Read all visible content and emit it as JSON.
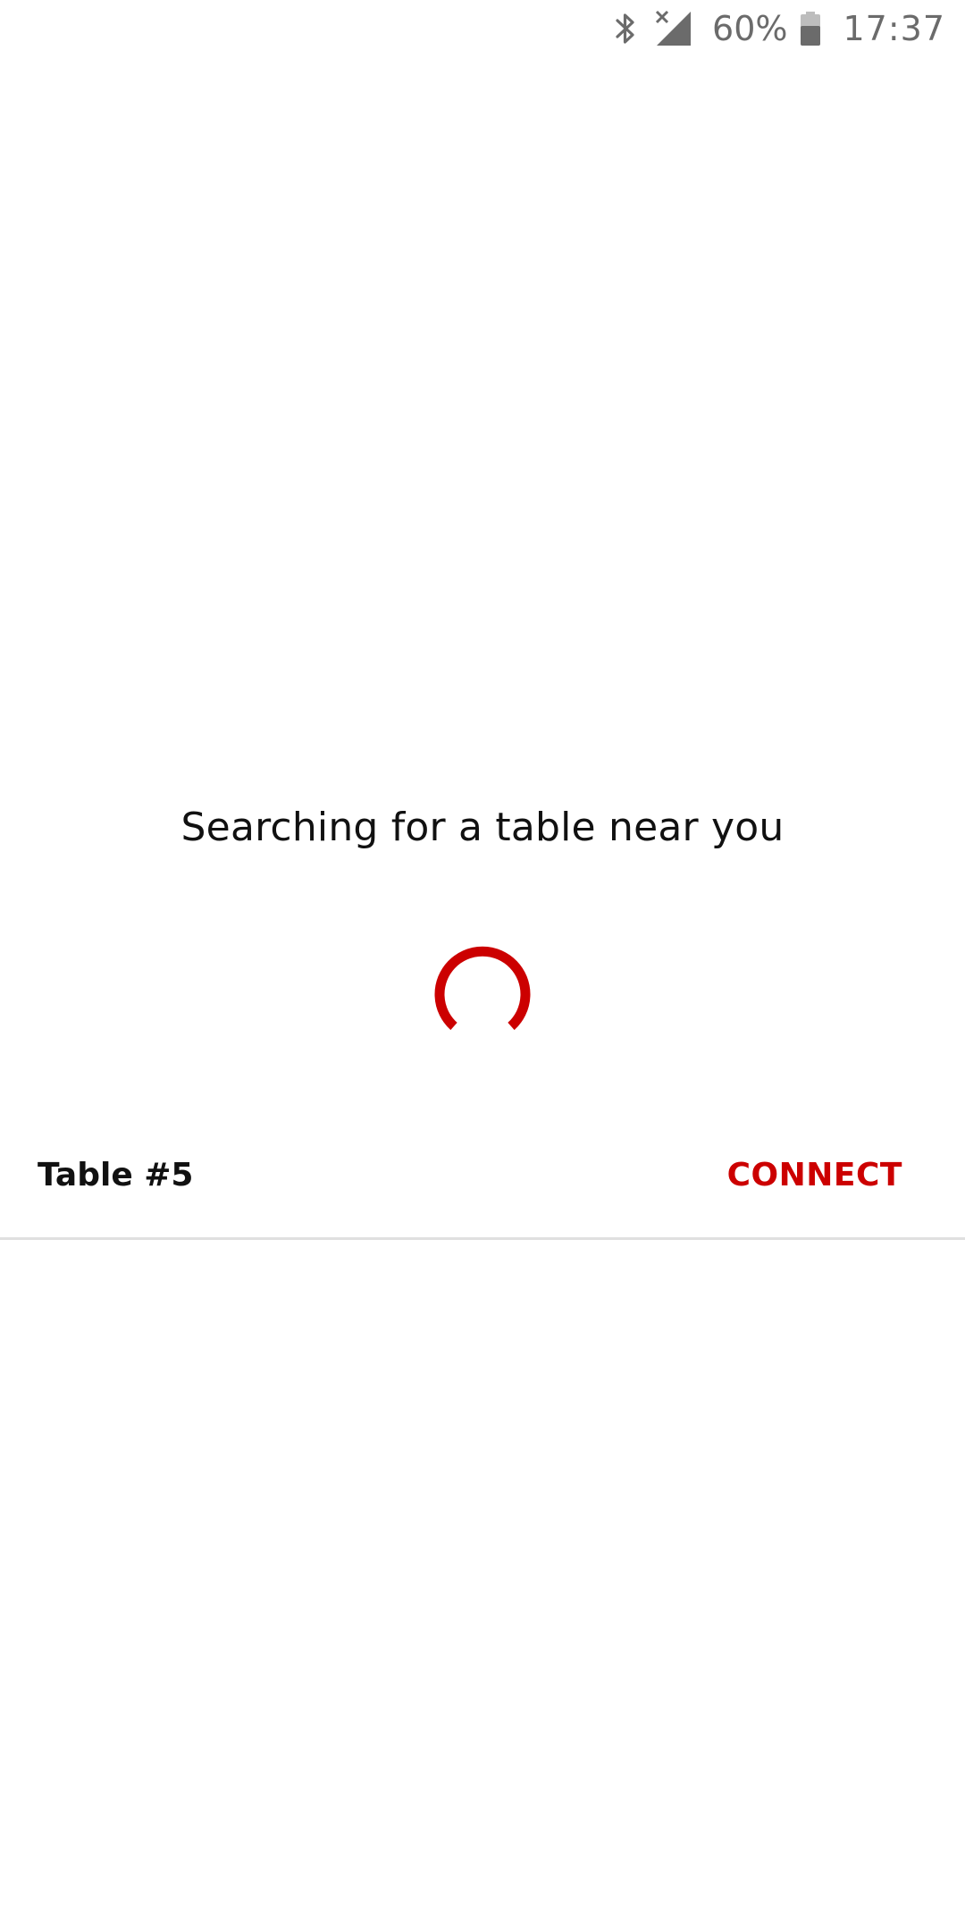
{
  "status_bar": {
    "icons": [
      "bluetooth-icon",
      "no-signal-icon",
      "battery-icon"
    ],
    "battery_percent": "60%",
    "time": "17:37",
    "icon_color": "#6b6b6b"
  },
  "search": {
    "title": "Searching for a table near you",
    "spinner_color": "#cc0000"
  },
  "tables": [
    {
      "name": "Table #5",
      "action_label": "CONNECT"
    }
  ],
  "colors": {
    "accent": "#cc0000",
    "divider": "#e0e0e0",
    "text": "#111111"
  }
}
